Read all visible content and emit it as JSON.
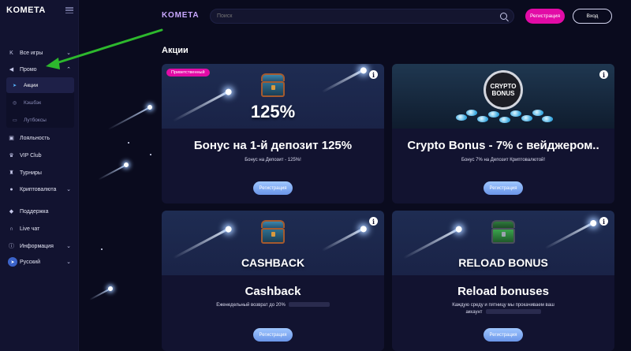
{
  "sidebar": {
    "logo": "KOMETA",
    "items": [
      {
        "label": "Все игры",
        "icon": "k-icon"
      },
      {
        "label": "Промо",
        "icon": "megaphone-icon"
      },
      {
        "label": "Лояльность",
        "icon": "gift-icon"
      },
      {
        "label": "VIP Club",
        "icon": "crown-icon"
      },
      {
        "label": "Турниры",
        "icon": "trophy-icon"
      },
      {
        "label": "Криптовалюта",
        "icon": "coins-icon"
      },
      {
        "label": "Поддержка",
        "icon": "chat-icon"
      },
      {
        "label": "Live чат",
        "icon": "headset-icon"
      },
      {
        "label": "Информация",
        "icon": "info-icon"
      },
      {
        "label": "Русский",
        "icon": "flag-ru-icon"
      }
    ],
    "promo_sub": [
      {
        "label": "Акции",
        "icon": "rocket-icon"
      },
      {
        "label": "Кэшбэк",
        "icon": "cashback-icon"
      },
      {
        "label": "Лутбоксы",
        "icon": "box-icon"
      }
    ],
    "telegram_icon": "telegram-icon"
  },
  "header": {
    "brand": "KOMETA",
    "search_placeholder": "Поиск",
    "register_label": "Регистрация",
    "login_label": "Вход"
  },
  "main": {
    "page_title": "Акции",
    "cards": [
      {
        "badge": "Приветственный",
        "banner_text": "125%",
        "title": "Бонус на 1-й депозит 125%",
        "description": "Бонус на Депозит - 125%!",
        "button": "Регистрация"
      },
      {
        "banner_text_1": "CRYPTO",
        "banner_text_2": "BONUS",
        "title": "Crypto Bonus - 7% с вейджером..",
        "description": "Бонус 7% на Депозит Криптовалютой!",
        "button": "Регистрация"
      },
      {
        "banner_text": "CASHBACK",
        "title": "Cashback",
        "description": "Еженедельный возврат до 20%",
        "button": "Регистрация"
      },
      {
        "banner_text": "RELOAD BONUS",
        "title": "Reload bonuses",
        "description_1": "Каждую среду и пятницу мы прокачиваем ваш",
        "description_2": "аккаунт",
        "button": "Регистрация"
      }
    ]
  },
  "colors": {
    "accent_pink": "#e20ba6",
    "button_blue": "#7ea7f0",
    "annotation_arrow": "#2db82d"
  }
}
